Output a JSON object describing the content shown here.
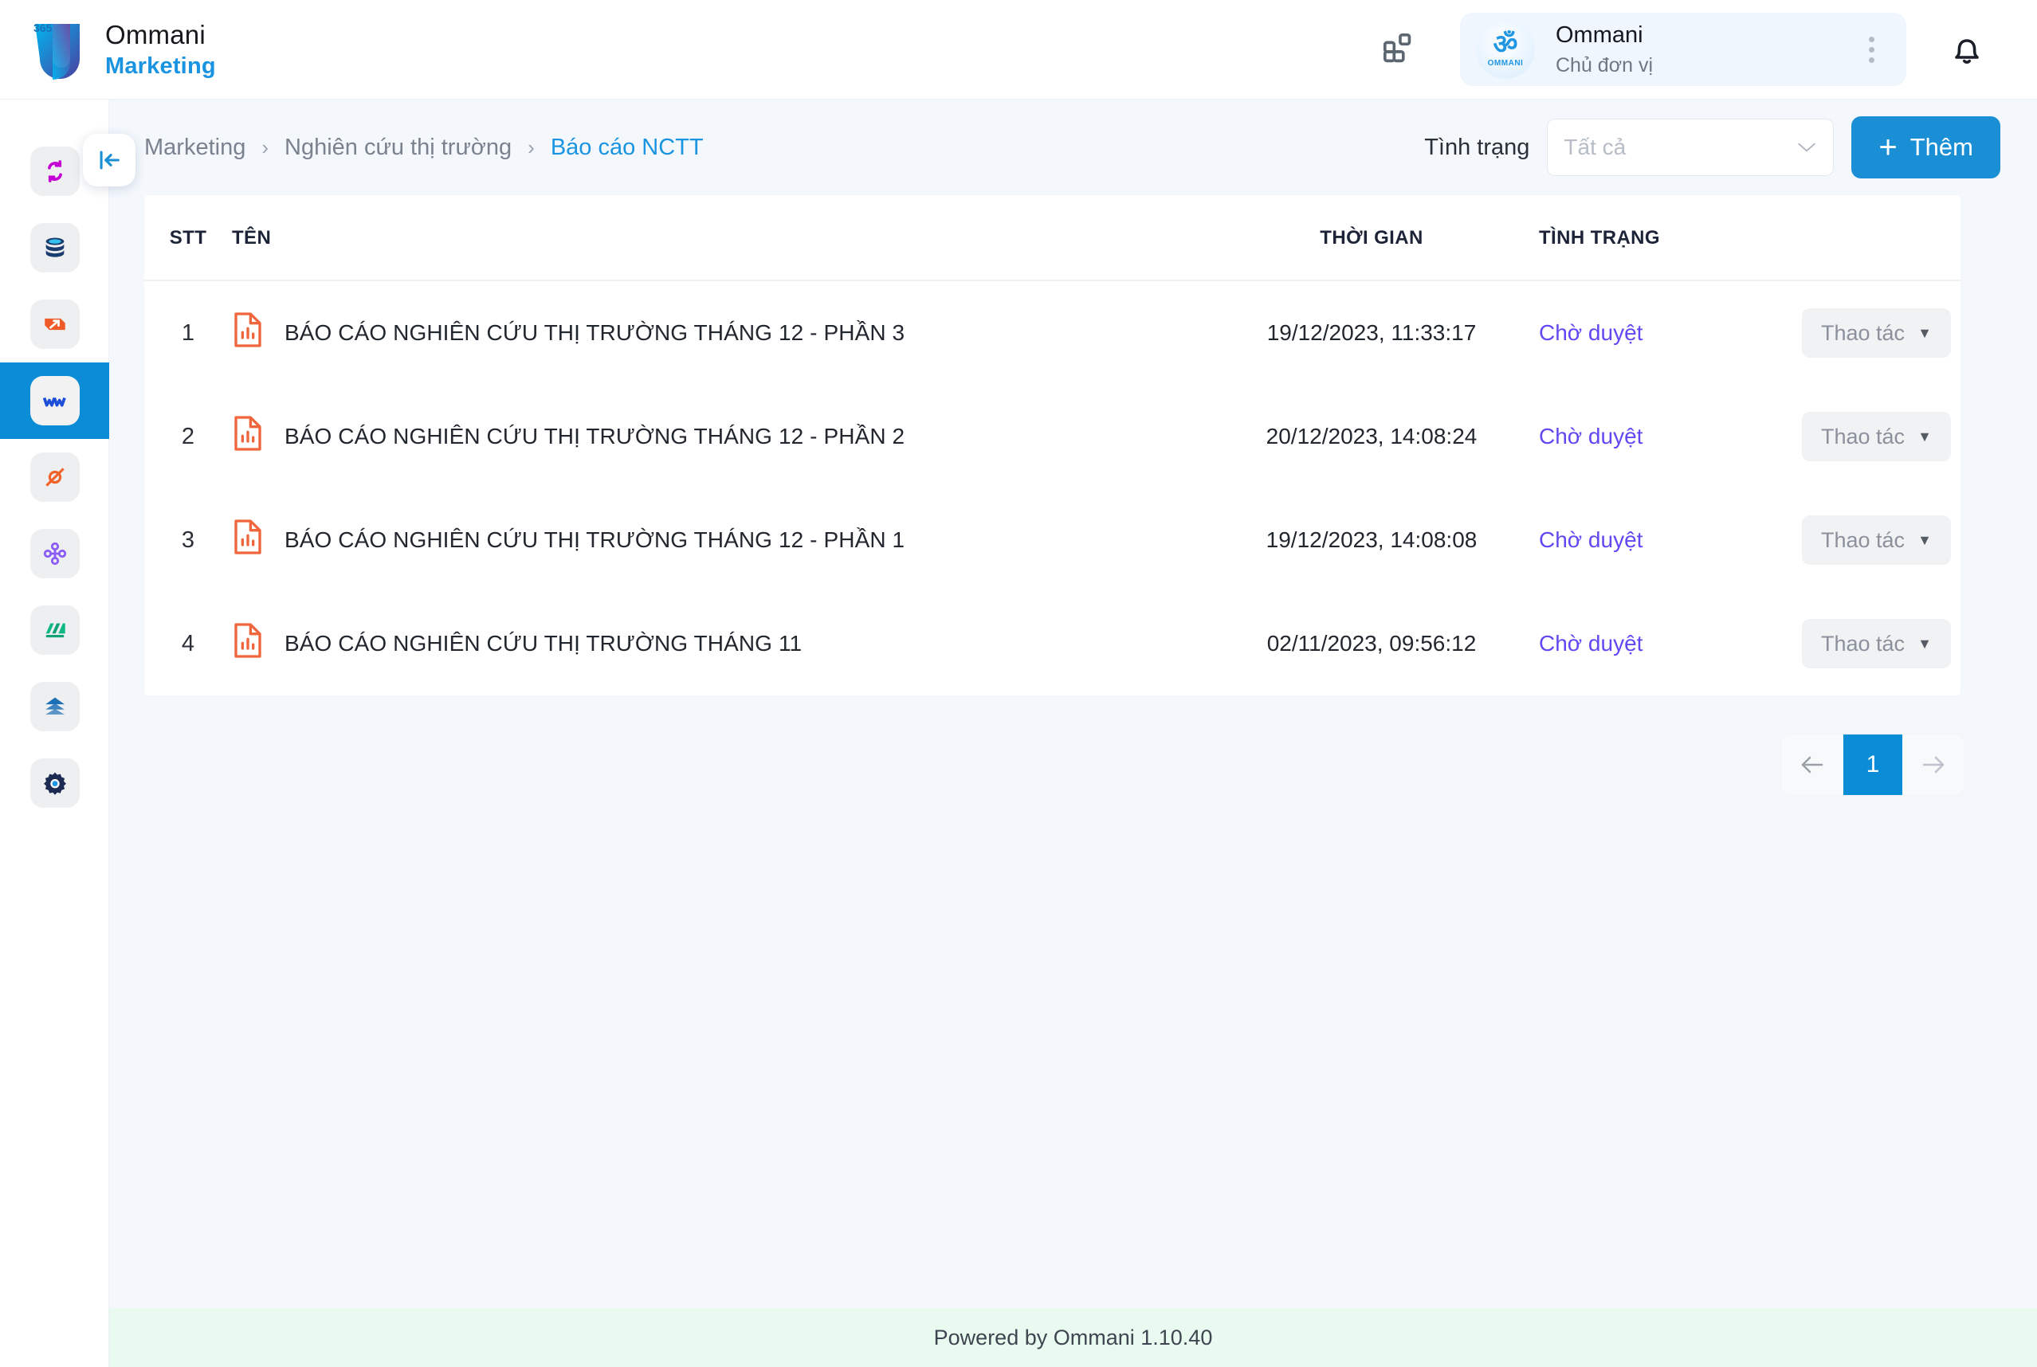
{
  "header": {
    "brand_title": "Ommani",
    "brand_subtitle": "Marketing",
    "logo_badge": "365",
    "apps_icon": "grid-apps-icon",
    "user": {
      "name": "Ommani",
      "role": "Chủ đơn vị",
      "avatar_glyph": "ॐ",
      "avatar_label": "OMMANI"
    },
    "notification_icon": "bell-icon",
    "more_icon": "three-dots-vertical-icon"
  },
  "sidebar": {
    "collapse_icon": "collapse-left-icon",
    "items": [
      {
        "name": "sidebar-item-sync",
        "icon": "sync-arrows-icon",
        "color": "#c400d4",
        "active": false
      },
      {
        "name": "sidebar-item-database",
        "icon": "database-icon",
        "color": "#1b3c6e",
        "active": false
      },
      {
        "name": "sidebar-item-boost",
        "icon": "arrow-box-icon",
        "color": "#f05a28",
        "active": false
      },
      {
        "name": "sidebar-item-marketing",
        "icon": "marketing-m-icon",
        "color": "#1d4ed8",
        "active": true
      },
      {
        "name": "sidebar-item-loop",
        "icon": "loop-icon",
        "color": "#f1632a",
        "active": false
      },
      {
        "name": "sidebar-item-network",
        "icon": "network-nodes-icon",
        "color": "#8b5cf6",
        "active": false
      },
      {
        "name": "sidebar-item-finance",
        "icon": "layers-green-icon",
        "color": "#10b981",
        "active": false
      },
      {
        "name": "sidebar-item-stack",
        "icon": "stack-arrow-icon",
        "color": "#1c6fb5",
        "active": false
      },
      {
        "name": "sidebar-item-settings",
        "icon": "gear-icon",
        "color": "#1d2a52",
        "active": false
      }
    ]
  },
  "breadcrumb": {
    "items": [
      "Marketing",
      "Nghiên cứu thị trường",
      "Báo cáo NCTT"
    ],
    "separator": "›"
  },
  "filters": {
    "status_label": "Tình trạng",
    "status_placeholder": "Tất cả",
    "caret_icon": "chevron-down-icon"
  },
  "actions": {
    "add_label": "Thêm",
    "add_icon": "plus-icon"
  },
  "table": {
    "columns": [
      "STT",
      "TÊN",
      "THỜI GIAN",
      "TÌNH TRẠNG",
      ""
    ],
    "row_action_label": "Thao tác",
    "row_action_caret": "▼",
    "file_icon": "document-chart-icon",
    "rows": [
      {
        "stt": "1",
        "name": "BÁO CÁO NGHIÊN CỨU THỊ TRƯỜNG THÁNG 12 - PHẦN 3",
        "time": "19/12/2023, 11:33:17",
        "status": "Chờ duyệt"
      },
      {
        "stt": "2",
        "name": "BÁO CÁO NGHIÊN CỨU THỊ TRƯỜNG THÁNG 12 - PHẦN 2",
        "time": "20/12/2023, 14:08:24",
        "status": "Chờ duyệt"
      },
      {
        "stt": "3",
        "name": "BÁO CÁO NGHIÊN CỨU THỊ TRƯỜNG THÁNG 12 - PHẦN 1",
        "time": "19/12/2023, 14:08:08",
        "status": "Chờ duyệt"
      },
      {
        "stt": "4",
        "name": "BÁO CÁO NGHIÊN CỨU THỊ TRƯỜNG THÁNG 11",
        "time": "02/11/2023, 09:56:12",
        "status": "Chờ duyệt"
      }
    ]
  },
  "pagination": {
    "prev_icon": "arrow-left-icon",
    "next_icon": "arrow-right-icon",
    "current_page": "1"
  },
  "footer": {
    "text": "Powered by Ommani 1.10.40"
  },
  "colors": {
    "accent_blue": "#1a8fd6",
    "brand_blue": "#1a94e0",
    "status_purple": "#6049f2",
    "file_orange": "#f0663c",
    "footer_bg": "#e9fbf0",
    "page_bg": "#f4f8fd"
  }
}
